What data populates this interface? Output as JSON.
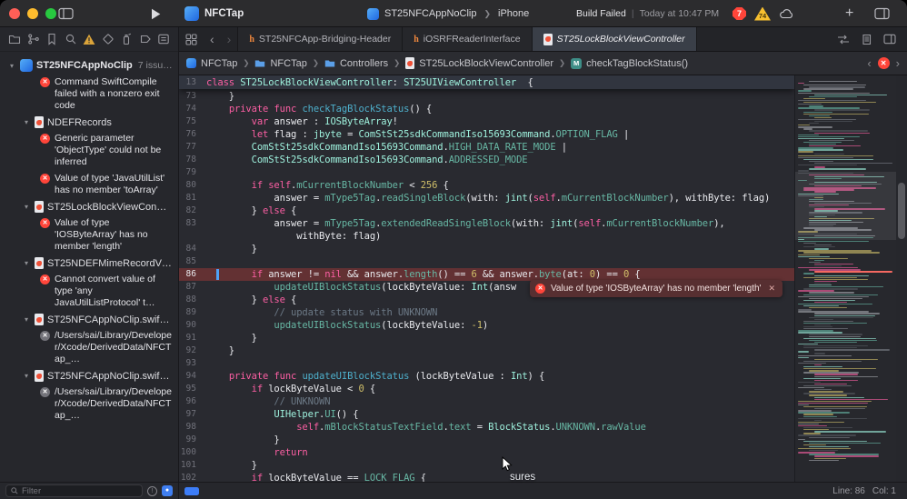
{
  "toolbar": {
    "project_name": "NFCTap",
    "scheme": "ST25NFCAppNoClip",
    "device": "iPhone",
    "status_primary": "Build Failed",
    "status_secondary": "Today at 10:47 PM",
    "error_count": "7",
    "warning_count": "74"
  },
  "tabs": [
    {
      "label": "ST25NFCApp-Bridging-Header"
    },
    {
      "label": "iOSRFReaderInterface"
    },
    {
      "label": "ST25LockBlockViewController"
    }
  ],
  "jumpbar": {
    "items": [
      "NFCTap",
      "NFCTap",
      "Controllers",
      "ST25LockBlockViewController",
      "checkTagBlockStatus()"
    ]
  },
  "sidebar": {
    "filter_placeholder": "Filter",
    "issues": [
      {
        "type": "project",
        "label": "ST25NFCAppNoClip",
        "badge": "7 issu…"
      },
      {
        "type": "error",
        "text": "Command SwiftCompile failed with a nonzero exit code"
      },
      {
        "type": "file",
        "label": "NDEFRecords"
      },
      {
        "type": "error",
        "text": "Generic parameter 'ObjectType' could not be inferred"
      },
      {
        "type": "error",
        "text": "Value of type 'JavaUtilList' has no member 'toArray'"
      },
      {
        "type": "file",
        "label": "ST25LockBlockViewCon…"
      },
      {
        "type": "error",
        "text": "Value of type 'IOSByteArray' has no member 'length'"
      },
      {
        "type": "file",
        "label": "ST25NDEFMimeRecordV…"
      },
      {
        "type": "error",
        "text": "Cannot convert value of type 'any JavaUtilListProtocol' t…"
      },
      {
        "type": "file",
        "label": "ST25NFCAppNoClip.swif…"
      },
      {
        "type": "error",
        "dim": true,
        "text": "/Users/sai/Library/Developer/Xcode/DerivedData/NFCTap_…"
      },
      {
        "type": "file",
        "label": "ST25NFCAppNoClip.swif…"
      },
      {
        "type": "error",
        "dim": true,
        "text": "/Users/sai/Library/Developer/Xcode/DerivedData/NFCTap_…"
      }
    ]
  },
  "editor": {
    "token_colors": {
      "k": "#fc5fa3",
      "t": "#9ef1dd",
      "m": "#67b7a4",
      "d": "#4eb0cc",
      "n": "#d0bf69",
      "c": "#6c7986",
      "p": "#e8e9ed"
    },
    "sticky": {
      "num": "13",
      "tokens": [
        [
          "k",
          "class"
        ],
        [
          "p",
          " "
        ],
        [
          "t",
          "ST25LockBlockViewController"
        ],
        [
          "p",
          ": "
        ],
        [
          "t",
          "ST25UIViewController"
        ],
        [
          "p",
          "  {"
        ]
      ]
    },
    "lines": [
      {
        "num": "73",
        "tokens": [
          [
            "p",
            "    }"
          ]
        ]
      },
      {
        "num": "74",
        "tokens": [
          [
            "p",
            "    "
          ],
          [
            "k",
            "private"
          ],
          [
            "p",
            " "
          ],
          [
            "k",
            "func"
          ],
          [
            "p",
            " "
          ],
          [
            "d",
            "checkTagBlockStatus"
          ],
          [
            "p",
            "() {"
          ]
        ]
      },
      {
        "num": "75",
        "tokens": [
          [
            "p",
            "        "
          ],
          [
            "k",
            "var"
          ],
          [
            "p",
            " answer : "
          ],
          [
            "t",
            "IOSByteArray"
          ],
          [
            "p",
            "!"
          ]
        ]
      },
      {
        "num": "76",
        "tokens": [
          [
            "p",
            "        "
          ],
          [
            "k",
            "let"
          ],
          [
            "p",
            " flag : "
          ],
          [
            "t",
            "jbyte"
          ],
          [
            "p",
            " = "
          ],
          [
            "t",
            "ComStSt25sdkCommandIso15693Command"
          ],
          [
            "p",
            "."
          ],
          [
            "m",
            "OPTION_FLAG"
          ],
          [
            "p",
            " |"
          ]
        ]
      },
      {
        "num": "77",
        "tokens": [
          [
            "p",
            "        "
          ],
          [
            "t",
            "ComStSt25sdkCommandIso15693Command"
          ],
          [
            "p",
            "."
          ],
          [
            "m",
            "HIGH_DATA_RATE_MODE"
          ],
          [
            "p",
            " |"
          ]
        ]
      },
      {
        "num": "78",
        "tokens": [
          [
            "p",
            "        "
          ],
          [
            "t",
            "ComStSt25sdkCommandIso15693Command"
          ],
          [
            "p",
            "."
          ],
          [
            "m",
            "ADDRESSED_MODE"
          ]
        ]
      },
      {
        "num": "79",
        "tokens": []
      },
      {
        "num": "80",
        "tokens": [
          [
            "p",
            "        "
          ],
          [
            "k",
            "if"
          ],
          [
            "p",
            " "
          ],
          [
            "k",
            "self"
          ],
          [
            "p",
            "."
          ],
          [
            "m",
            "mCurrentBlockNumber"
          ],
          [
            "p",
            " < "
          ],
          [
            "n",
            "256"
          ],
          [
            "p",
            " {"
          ]
        ]
      },
      {
        "num": "81",
        "tokens": [
          [
            "p",
            "            answer = "
          ],
          [
            "m",
            "mType5Tag"
          ],
          [
            "p",
            "."
          ],
          [
            "m",
            "readSingleBlock"
          ],
          [
            "p",
            "(with: "
          ],
          [
            "t",
            "jint"
          ],
          [
            "p",
            "("
          ],
          [
            "k",
            "self"
          ],
          [
            "p",
            "."
          ],
          [
            "m",
            "mCurrentBlockNumber"
          ],
          [
            "p",
            "), withByte: flag)"
          ]
        ]
      },
      {
        "num": "82",
        "tokens": [
          [
            "p",
            "        } "
          ],
          [
            "k",
            "else"
          ],
          [
            "p",
            " {"
          ]
        ]
      },
      {
        "num": "83",
        "tokens": [
          [
            "p",
            "            answer = "
          ],
          [
            "m",
            "mType5Tag"
          ],
          [
            "p",
            "."
          ],
          [
            "m",
            "extendedReadSingleBlock"
          ],
          [
            "p",
            "(with: "
          ],
          [
            "t",
            "jint"
          ],
          [
            "p",
            "("
          ],
          [
            "k",
            "self"
          ],
          [
            "p",
            "."
          ],
          [
            "m",
            "mCurrentBlockNumber"
          ],
          [
            "p",
            "),"
          ]
        ]
      },
      {
        "num": "",
        "tokens": [
          [
            "p",
            "                withByte: flag)"
          ]
        ]
      },
      {
        "num": "84",
        "tokens": [
          [
            "p",
            "        }"
          ]
        ]
      },
      {
        "num": "85",
        "tokens": []
      },
      {
        "num": "86",
        "error": true,
        "tokens": [
          [
            "p",
            "        "
          ],
          [
            "k",
            "if"
          ],
          [
            "p",
            " answer != "
          ],
          [
            "k",
            "nil"
          ],
          [
            "p",
            " && answer."
          ],
          [
            "m",
            "length"
          ],
          [
            "p",
            "() == "
          ],
          [
            "n",
            "6"
          ],
          [
            "p",
            " && answer."
          ],
          [
            "m",
            "byte"
          ],
          [
            "p",
            "(at: "
          ],
          [
            "n",
            "0"
          ],
          [
            "p",
            ") == "
          ],
          [
            "n",
            "0"
          ],
          [
            "p",
            " {"
          ]
        ]
      },
      {
        "num": "87",
        "tokens": [
          [
            "p",
            "            "
          ],
          [
            "m",
            "updateUIBlockStatus"
          ],
          [
            "p",
            "(lockByteValue: "
          ],
          [
            "t",
            "Int"
          ],
          [
            "p",
            "(answ"
          ]
        ]
      },
      {
        "num": "88",
        "tokens": [
          [
            "p",
            "        } "
          ],
          [
            "k",
            "else"
          ],
          [
            "p",
            " {"
          ]
        ]
      },
      {
        "num": "89",
        "tokens": [
          [
            "p",
            "            "
          ],
          [
            "c",
            "// update status with UNKNOWN"
          ]
        ]
      },
      {
        "num": "90",
        "tokens": [
          [
            "p",
            "            "
          ],
          [
            "m",
            "updateUIBlockStatus"
          ],
          [
            "p",
            "(lockByteValue: "
          ],
          [
            "n",
            "-1"
          ],
          [
            "p",
            ")"
          ]
        ]
      },
      {
        "num": "91",
        "tokens": [
          [
            "p",
            "        }"
          ]
        ]
      },
      {
        "num": "92",
        "tokens": [
          [
            "p",
            "    }"
          ]
        ]
      },
      {
        "num": "93",
        "tokens": []
      },
      {
        "num": "94",
        "tokens": [
          [
            "p",
            "    "
          ],
          [
            "k",
            "private"
          ],
          [
            "p",
            " "
          ],
          [
            "k",
            "func"
          ],
          [
            "p",
            " "
          ],
          [
            "d",
            "updateUIBlockStatus"
          ],
          [
            "p",
            " (lockByteValue : "
          ],
          [
            "t",
            "Int"
          ],
          [
            "p",
            ") {"
          ]
        ]
      },
      {
        "num": "95",
        "tokens": [
          [
            "p",
            "        "
          ],
          [
            "k",
            "if"
          ],
          [
            "p",
            " lockByteValue < "
          ],
          [
            "n",
            "0"
          ],
          [
            "p",
            " {"
          ]
        ]
      },
      {
        "num": "96",
        "tokens": [
          [
            "p",
            "            "
          ],
          [
            "c",
            "// UNKNOWN"
          ]
        ]
      },
      {
        "num": "97",
        "tokens": [
          [
            "p",
            "            "
          ],
          [
            "t",
            "UIHelper"
          ],
          [
            "p",
            "."
          ],
          [
            "m",
            "UI"
          ],
          [
            "p",
            "() {"
          ]
        ]
      },
      {
        "num": "98",
        "tokens": [
          [
            "p",
            "                "
          ],
          [
            "k",
            "self"
          ],
          [
            "p",
            "."
          ],
          [
            "m",
            "mBlockStatusTextField"
          ],
          [
            "p",
            "."
          ],
          [
            "m",
            "text"
          ],
          [
            "p",
            " = "
          ],
          [
            "t",
            "BlockStatus"
          ],
          [
            "p",
            "."
          ],
          [
            "m",
            "UNKNOWN"
          ],
          [
            "p",
            "."
          ],
          [
            "m",
            "rawValue"
          ]
        ]
      },
      {
        "num": "99",
        "tokens": [
          [
            "p",
            "            }"
          ]
        ]
      },
      {
        "num": "100",
        "tokens": [
          [
            "p",
            "            "
          ],
          [
            "k",
            "return"
          ]
        ]
      },
      {
        "num": "101",
        "tokens": [
          [
            "p",
            "        }"
          ]
        ]
      },
      {
        "num": "102",
        "tokens": [
          [
            "p",
            "        "
          ],
          [
            "k",
            "if"
          ],
          [
            "p",
            " lockByteValue == "
          ],
          [
            "m",
            "LOCK_FLAG"
          ],
          [
            "p",
            " {"
          ]
        ]
      }
    ],
    "popup": {
      "text": "Value of type 'IOSByteArray' has no member 'length'",
      "close": "✕"
    }
  },
  "statusbar": {
    "line": "Line: 86",
    "col": "Col: 1"
  },
  "floating_text": "sures"
}
